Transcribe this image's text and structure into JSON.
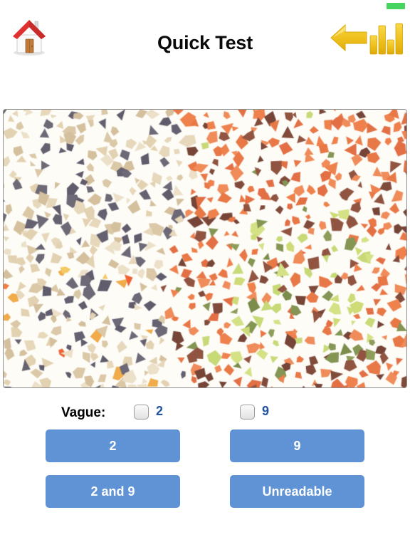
{
  "header": {
    "title": "Quick Test",
    "home_icon": "home-icon",
    "back_icon": "back-arrow-icon",
    "stats_icon": "bar-chart-icon",
    "badge_color": "#46d35f"
  },
  "plate": {
    "name": "ishihara-color-vision-plate",
    "description": "Ishihara color vision test plate mosaic",
    "border_color": "#8c8c8c",
    "background": "#fdfcf7",
    "left_palette": [
      "#d9c5a2",
      "#e6d6b8",
      "#5d5868",
      "#ecdfc6",
      "#f0a63f",
      "#f4c75a",
      "#ef5a2a"
    ],
    "right_palette": [
      "#e8703c",
      "#ef7a42",
      "#7a4030",
      "#8a4a36",
      "#c5d870",
      "#d3e07e",
      "#7d8f4a",
      "#87974f"
    ]
  },
  "vague": {
    "label": "Vague:",
    "options": [
      {
        "label": "2",
        "checked": false
      },
      {
        "label": "9",
        "checked": false
      }
    ],
    "label_color": "#23529f"
  },
  "answers": {
    "accent": "#5f93d6",
    "buttons": [
      {
        "label": "2"
      },
      {
        "label": "9"
      },
      {
        "label": "2 and 9"
      },
      {
        "label": "Unreadable"
      }
    ]
  }
}
